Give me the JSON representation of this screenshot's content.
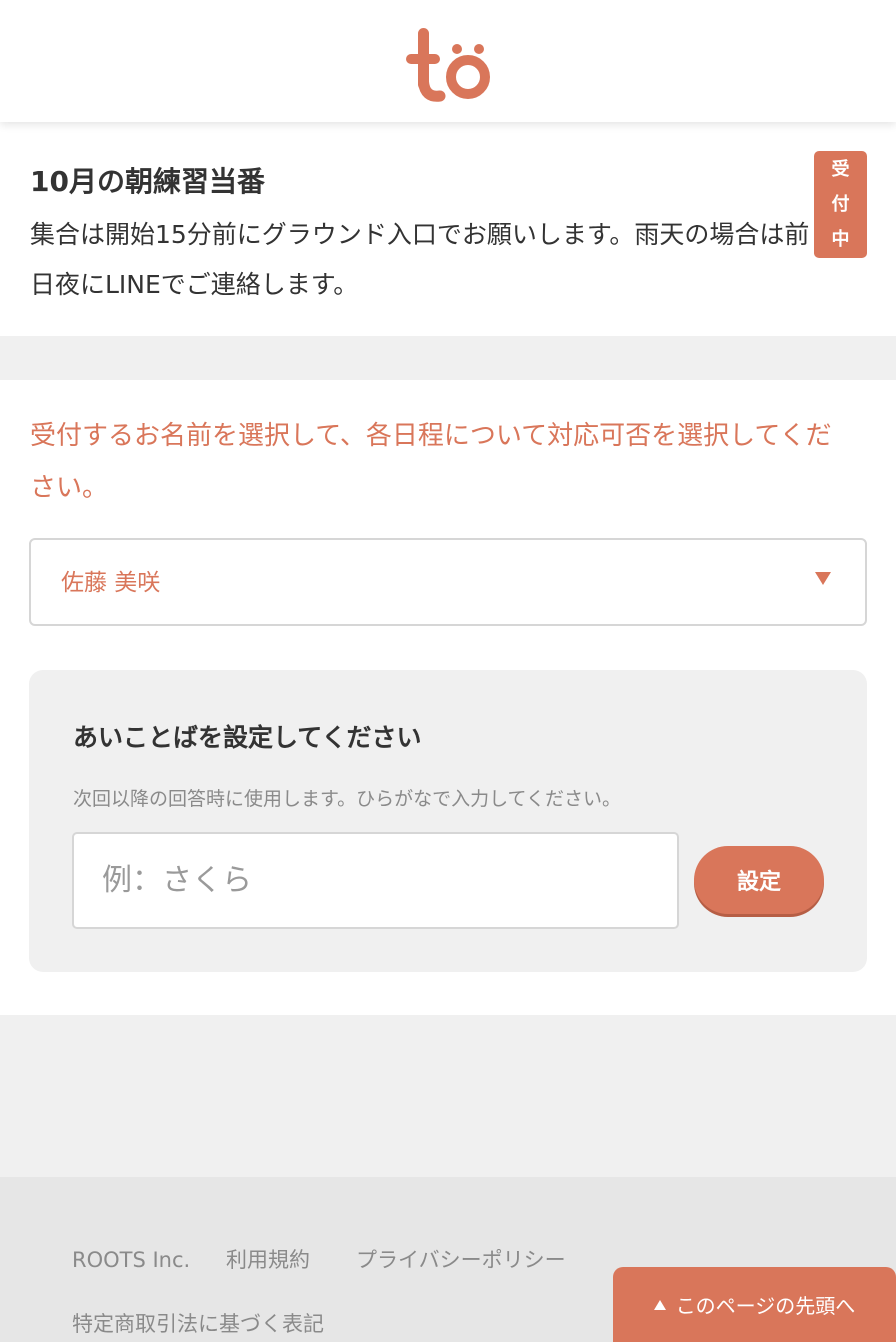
{
  "header": {
    "logo_text": "to",
    "brand_color": "#d9765a"
  },
  "event": {
    "title": "10月の朝練習当番",
    "description": "集合は開始15分前にグラウンド入口でお願いします。雨天の場合は前日夜にLINEでご連絡します。",
    "status_chars": [
      "受",
      "付",
      "中"
    ]
  },
  "form": {
    "instruction": "受付するお名前を選択して、各日程について対応可否を選択してください。",
    "name_select": {
      "selected": "佐藤 美咲"
    },
    "password": {
      "title": "あいことばを設定してください",
      "help": "次回以降の回答時に使用します。ひらがなで入力してください。",
      "placeholder": "例：さくら",
      "value": "",
      "button_label": "設定"
    }
  },
  "footer": {
    "links": [
      "ROOTS Inc.",
      "利用規約",
      "プライバシーポリシー",
      "特定商取引法に基づく表記"
    ],
    "back_to_top": "このページの先頭へ"
  }
}
